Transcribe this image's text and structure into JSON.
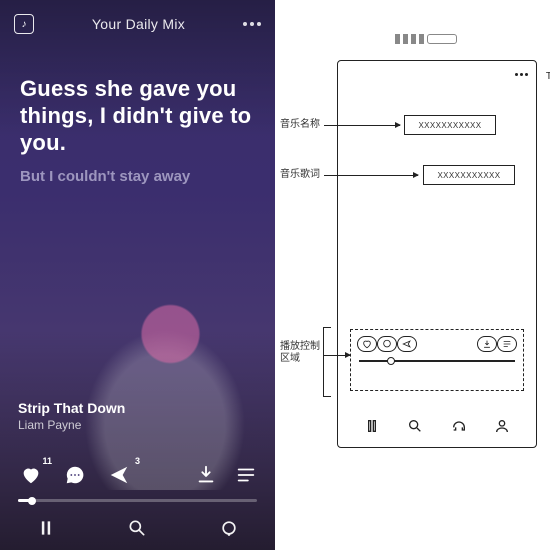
{
  "player": {
    "header_title": "Your Daily Mix",
    "lyric_main": "Guess she gave you things, I didn't give to you.",
    "lyric_sub": "But I couldn't stay away",
    "track_title": "Strip That Down",
    "track_artist": "Liam Payne",
    "like_count": "11",
    "share_count": "3",
    "progress_pct": 6
  },
  "wire": {
    "label_name": "音乐名称",
    "label_lyric": "音乐歌词",
    "label_ctrl_l1": "播放控制",
    "label_ctrl_l2": "区域",
    "placeholder": "XXXXXXXXXXX",
    "corner_T": "T"
  }
}
